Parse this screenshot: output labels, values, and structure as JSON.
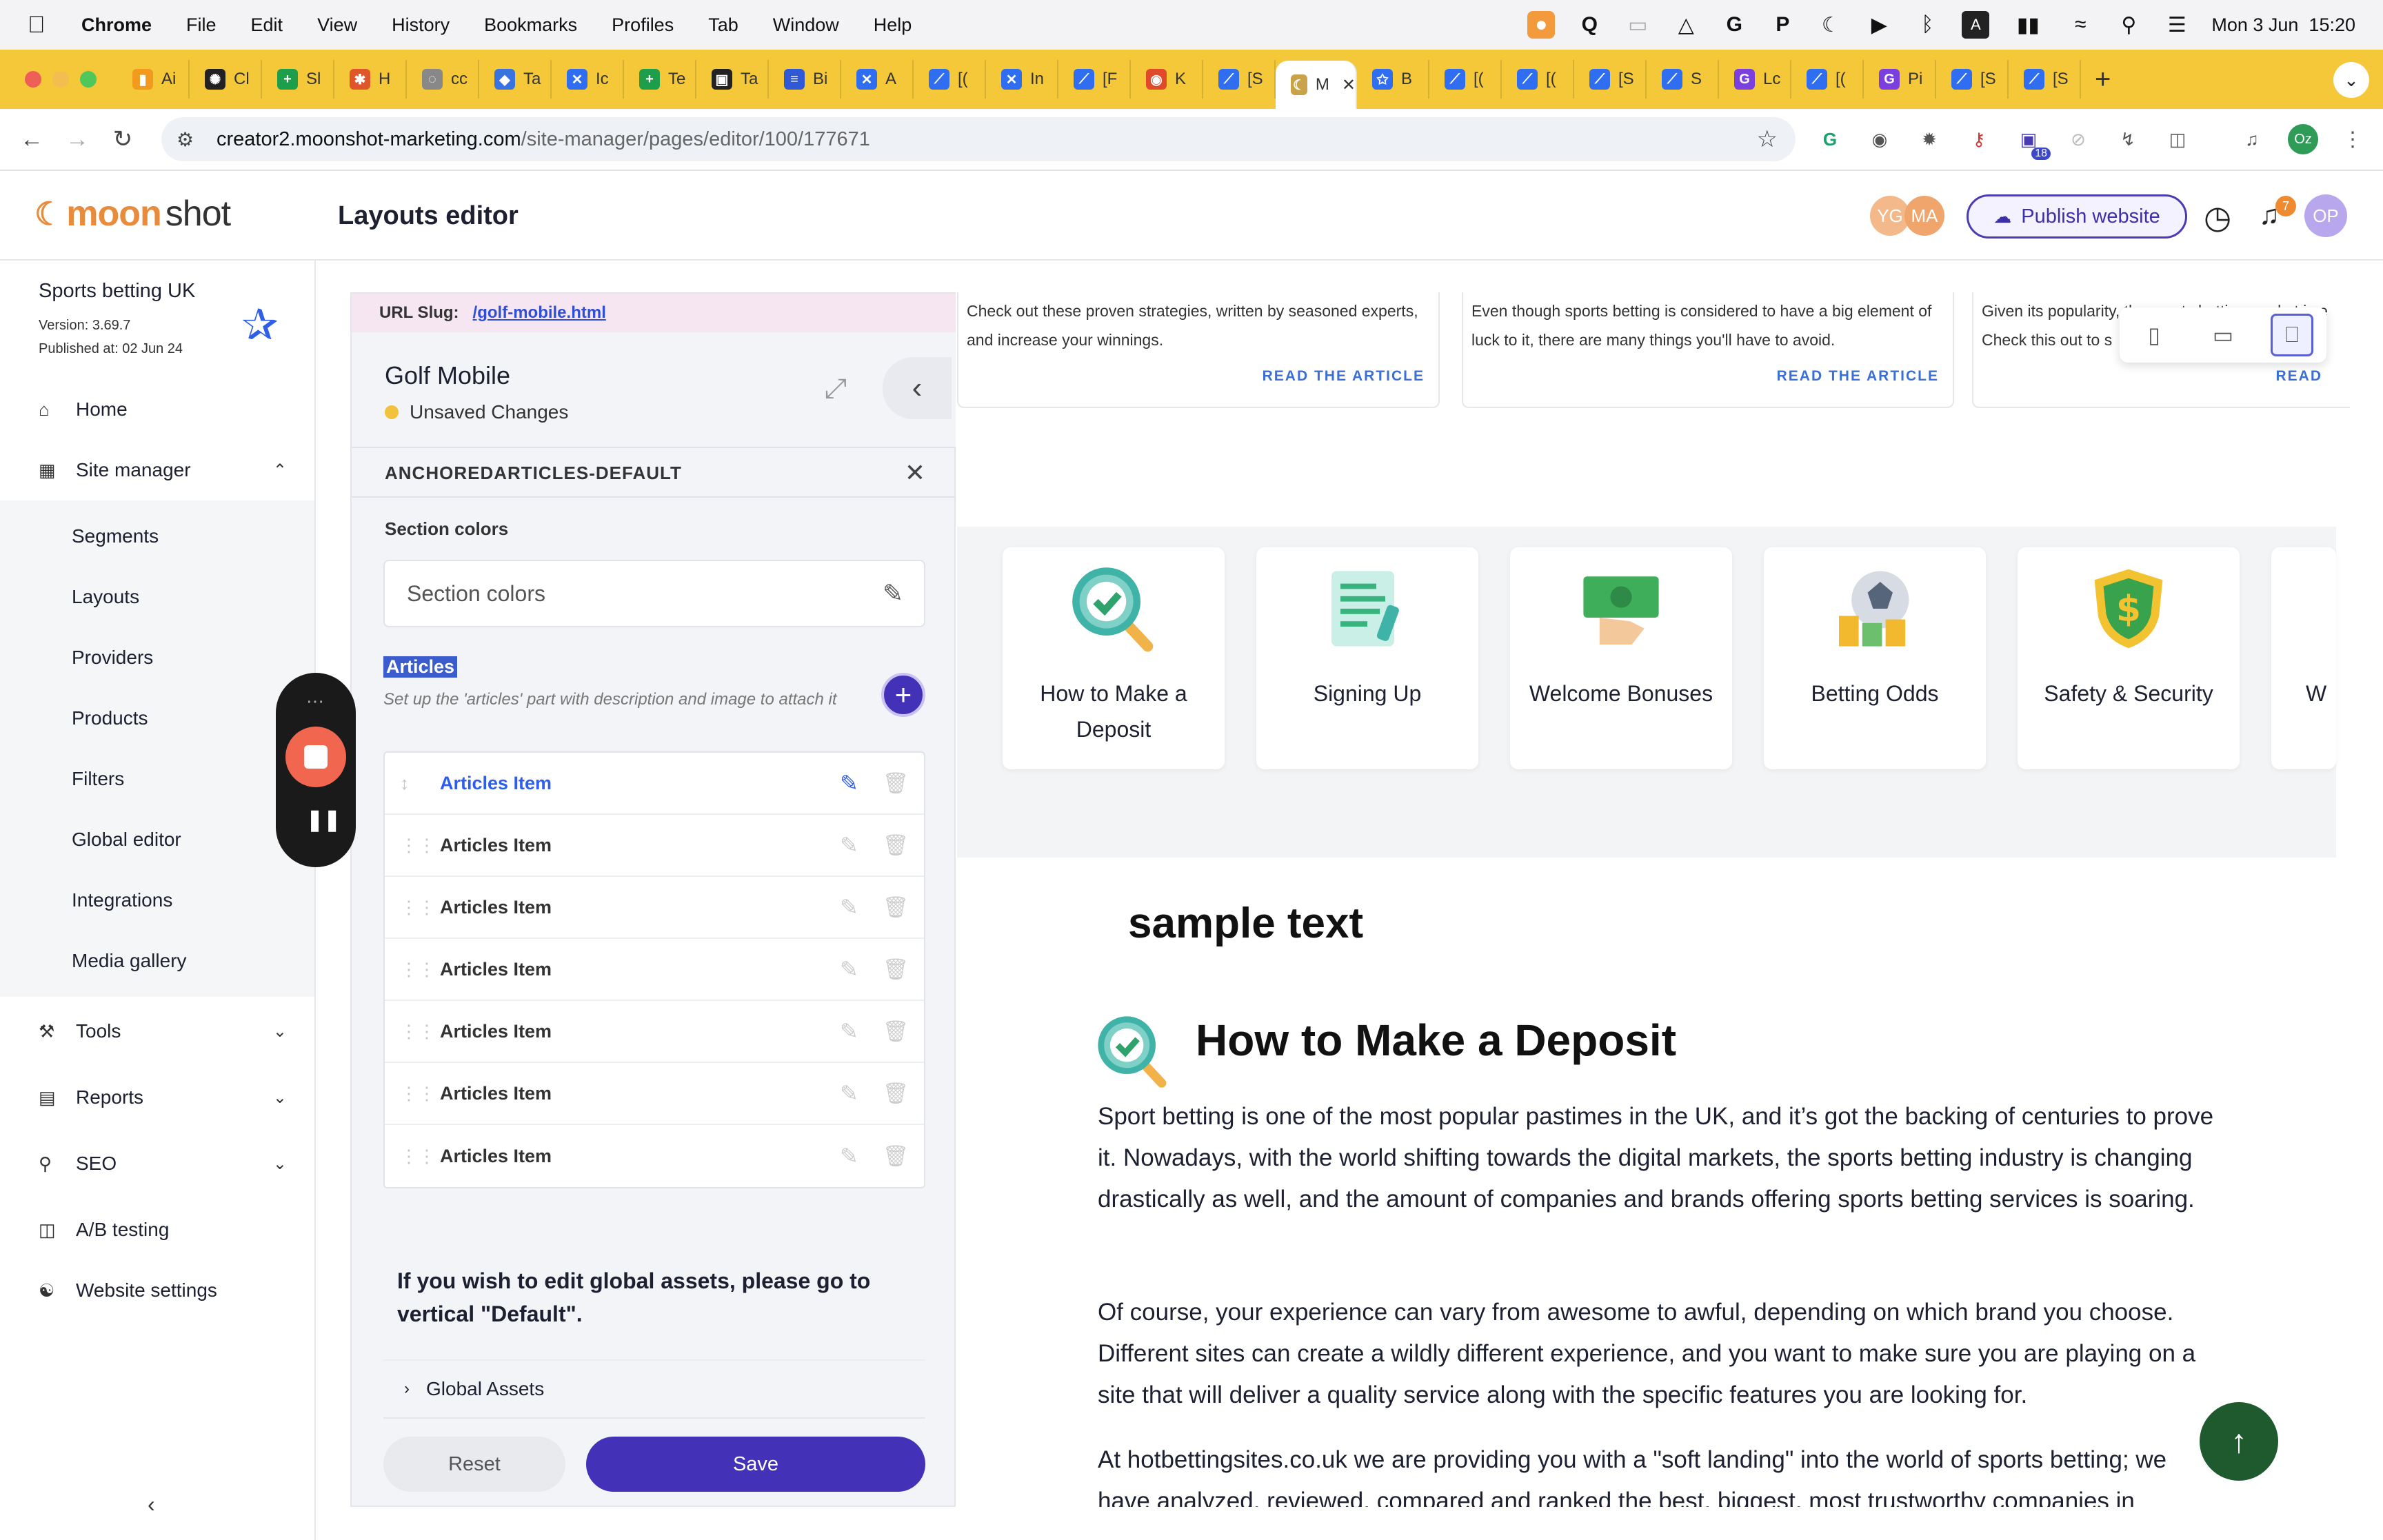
{
  "menubar": {
    "app": "Chrome",
    "items": [
      "File",
      "Edit",
      "View",
      "History",
      "Bookmarks",
      "Profiles",
      "Tab",
      "Window",
      "Help"
    ],
    "datetime": "Mon 3 Jun  15:20"
  },
  "tabs": [
    {
      "label": "Ai",
      "color": "#f29a1e",
      "glyph": "▮"
    },
    {
      "label": "Cl",
      "color": "#222",
      "glyph": "✺"
    },
    {
      "label": "Sl",
      "color": "#1e9d4a",
      "glyph": "+"
    },
    {
      "label": "H",
      "color": "#e0562b",
      "glyph": "✱"
    },
    {
      "label": "cc",
      "color": "#888",
      "glyph": "◌"
    },
    {
      "label": "Ta",
      "color": "#3873e0",
      "glyph": "◆"
    },
    {
      "label": "Ic",
      "color": "#2f6ef0",
      "glyph": "✕"
    },
    {
      "label": "Te",
      "color": "#1e9d4a",
      "glyph": "+"
    },
    {
      "label": "Ta",
      "color": "#222",
      "glyph": "▣"
    },
    {
      "label": "Bi",
      "color": "#3059d6",
      "glyph": "≡"
    },
    {
      "label": "A",
      "color": "#2f6ef0",
      "glyph": "✕"
    },
    {
      "label": "[(",
      "color": "#2f6ef0",
      "glyph": "⟋"
    },
    {
      "label": "In",
      "color": "#2f6ef0",
      "glyph": "✕"
    },
    {
      "label": "[F",
      "color": "#2f6ef0",
      "glyph": "⟋"
    },
    {
      "label": "K",
      "color": "#e04a2b",
      "glyph": "◉"
    },
    {
      "label": "[S",
      "color": "#2f6ef0",
      "glyph": "⟋"
    },
    {
      "label": "M",
      "color": "#c9a34a",
      "glyph": "☾",
      "active": true
    },
    {
      "label": "B",
      "color": "#2f6ef0",
      "glyph": "✩"
    },
    {
      "label": "[(",
      "color": "#2f6ef0",
      "glyph": "⟋"
    },
    {
      "label": "[(",
      "color": "#2f6ef0",
      "glyph": "⟋"
    },
    {
      "label": "[S",
      "color": "#2f6ef0",
      "glyph": "⟋"
    },
    {
      "label": "S",
      "color": "#2f6ef0",
      "glyph": "⟋"
    },
    {
      "label": "Lc",
      "color": "#7b3fe0",
      "glyph": "G"
    },
    {
      "label": "[(",
      "color": "#2f6ef0",
      "glyph": "⟋"
    },
    {
      "label": "Pi",
      "color": "#7b3fe0",
      "glyph": "G"
    },
    {
      "label": "[S",
      "color": "#2f6ef0",
      "glyph": "⟋"
    },
    {
      "label": "[S",
      "color": "#2f6ef0",
      "glyph": "⟋"
    }
  ],
  "address": {
    "host": "creator2.moonshot-marketing.com",
    "path": "/site-manager/pages/editor/100/177671",
    "ext_badge": "18",
    "profile": "Oz"
  },
  "header": {
    "logo_a": "moon",
    "logo_b": "shot",
    "title": "Layouts editor",
    "avatars": [
      "YG",
      "MA"
    ],
    "publish": "Publish website",
    "notif_count": "7",
    "user": "OP"
  },
  "sidebar": {
    "site_name": "Sports betting UK",
    "version": "Version: 3.69.7",
    "published": "Published at: 02 Jun 24",
    "home": "Home",
    "site_manager": "Site manager",
    "sub_items": [
      "Segments",
      "Layouts",
      "Providers",
      "Products",
      "Filters",
      "Global editor",
      "Integrations",
      "Media gallery"
    ],
    "tools": "Tools",
    "reports": "Reports",
    "seo": "SEO",
    "ab": "A/B testing",
    "settings": "Website settings"
  },
  "panel": {
    "slug_label": "URL Slug:",
    "slug": "/golf-mobile.html",
    "page_name": "Golf Mobile",
    "unsaved": "Unsaved Changes",
    "section_code": "ANCHOREDARTICLES-DEFAULT",
    "section_colors_label": "Section colors",
    "section_colors_value": "Section colors",
    "articles_label": "Articles",
    "articles_desc": "Set up the 'articles' part with description and image to attach it",
    "items": [
      "Articles Item",
      "Articles Item",
      "Articles Item",
      "Articles Item",
      "Articles Item",
      "Articles Item",
      "Articles Item"
    ],
    "note": "If you wish to edit global assets, please go to vertical \"Default\".",
    "global_assets": "Global Assets",
    "reset": "Reset",
    "save": "Save"
  },
  "preview": {
    "article_cards": [
      {
        "text": "Check out these proven strategies, written by seasoned experts, and increase your winnings.",
        "link": "READ THE ARTICLE"
      },
      {
        "text": "Even though sports betting is considered to have a big element of luck to it, there are many things you'll have to avoid.",
        "link": "READ THE ARTICLE"
      },
      {
        "text": "Given its popularity, the sports betting market is e Check this out to s                    y                 our p",
        "link": "READ"
      }
    ],
    "categories": [
      {
        "label": "How to Make a Deposit",
        "icon": "magnifier-check-icon"
      },
      {
        "label": "Signing Up",
        "icon": "form-pen-icon"
      },
      {
        "label": "Welcome Bonuses",
        "icon": "cash-hand-icon"
      },
      {
        "label": "Betting Odds",
        "icon": "ball-coins-icon"
      },
      {
        "label": "Safety & Security",
        "icon": "shield-dollar-icon"
      },
      {
        "label": "W",
        "icon": "partial-card"
      }
    ],
    "sample": "sample text",
    "h2": "How to Make a Deposit",
    "p1": "Sport betting is one of the most popular pastimes in the UK, and it’s got the backing of centuries to prove it. Nowadays, with the world shifting towards the digital markets, the sports betting industry is changing drastically as well, and the amount of companies and brands offering sports betting services is soaring.",
    "p2": "Of course, your experience can vary from awesome to awful, depending on which brand you choose. Different sites can create a wildly different experience, and you want to make sure you are playing on a site that will deliver a quality service along with the specific features you are looking for.",
    "p3": "At hotbettingsites.co.uk we are providing you with a \"soft landing\" into the world of sports betting; we have analyzed, reviewed, compared and ranked the best, biggest, most trustworthy companies in"
  },
  "colors": {
    "accent": "#4332b8",
    "link": "#2f5ee8",
    "tabstrip": "#f5c83a",
    "recorder_stop": "#f0664e",
    "to_top": "#1f5a2f"
  }
}
